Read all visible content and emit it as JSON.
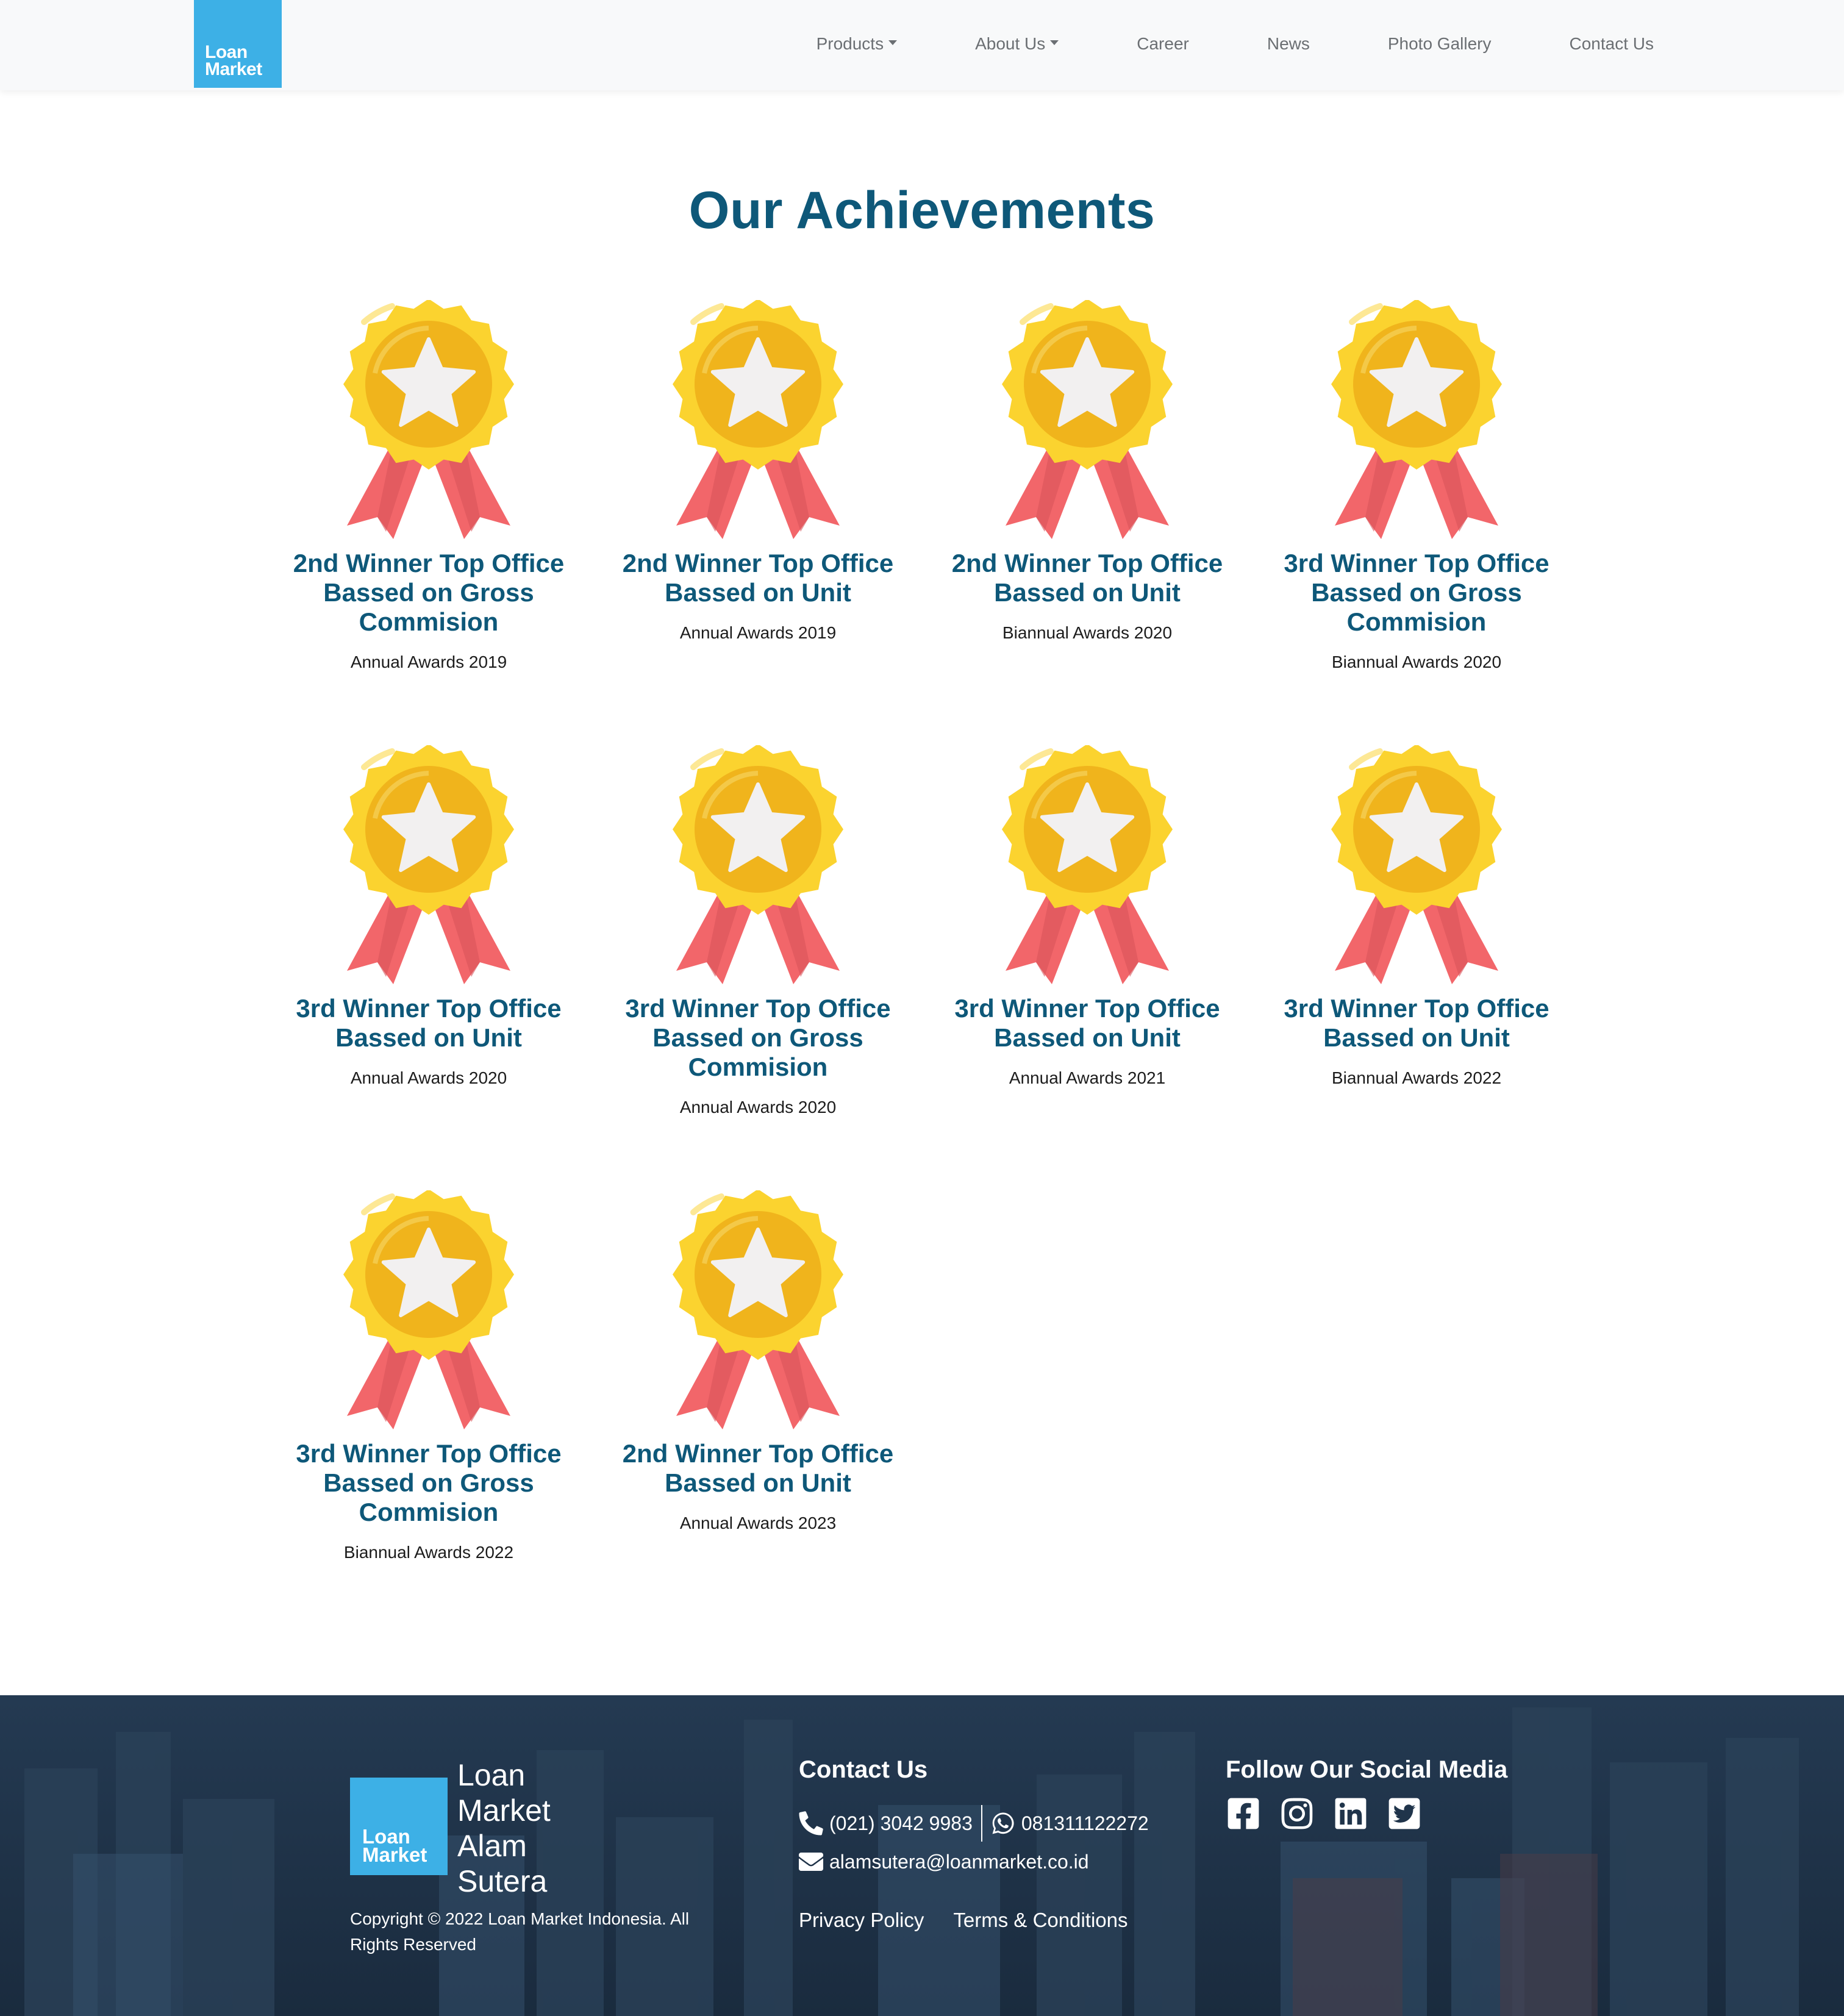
{
  "brand": {
    "line1": "Loan",
    "line2": "Market"
  },
  "nav": {
    "items": [
      {
        "label": "Products",
        "dropdown": true
      },
      {
        "label": "About Us",
        "dropdown": true
      },
      {
        "label": "Career",
        "dropdown": false
      },
      {
        "label": "News",
        "dropdown": false
      },
      {
        "label": "Photo Gallery",
        "dropdown": false
      },
      {
        "label": "Contact Us",
        "dropdown": false
      }
    ]
  },
  "main": {
    "title": "Our Achievements",
    "awards": [
      {
        "title": "2nd Winner Top Office Bassed on Gross Commision",
        "subtitle": "Annual Awards 2019"
      },
      {
        "title": "2nd Winner Top Office Bassed on Unit",
        "subtitle": "Annual Awards 2019"
      },
      {
        "title": "2nd Winner Top Office Bassed on Unit",
        "subtitle": "Biannual Awards 2020"
      },
      {
        "title": "3rd Winner Top Office Bassed on Gross Commision",
        "subtitle": "Biannual Awards 2020"
      },
      {
        "title": "3rd Winner Top Office Bassed on Unit",
        "subtitle": "Annual Awards 2020"
      },
      {
        "title": "3rd Winner Top Office Bassed on Gross Commision",
        "subtitle": "Annual Awards 2020"
      },
      {
        "title": "3rd Winner Top Office Bassed on Unit",
        "subtitle": "Annual Awards 2021"
      },
      {
        "title": "3rd Winner Top Office Bassed on Unit",
        "subtitle": "Biannual Awards 2022"
      },
      {
        "title": "3rd Winner Top Office Bassed on Gross Commision",
        "subtitle": "Biannual Awards 2022"
      },
      {
        "title": "2nd Winner Top Office Bassed on Unit",
        "subtitle": "Annual Awards 2023"
      }
    ]
  },
  "footer": {
    "logo": {
      "line1": "Loan",
      "line2": "Market"
    },
    "office_name": "Loan Market Alam Sutera",
    "copyright": "Copyright © 2022 Loan Market Indonesia. All Rights Reserved",
    "contact": {
      "title": "Contact Us",
      "phone": "(021) 3042 9983",
      "whatsapp": "081311122272",
      "email": "alamsutera@loanmarket.co.id"
    },
    "links": {
      "privacy": "Privacy Policy",
      "terms": "Terms & Conditions"
    },
    "social": {
      "title": "Follow Our Social Media",
      "icons": [
        "facebook-icon",
        "instagram-icon",
        "linkedin-icon",
        "twitter-icon"
      ]
    }
  },
  "colors": {
    "brand_blue": "#3db0e6",
    "heading_blue": "#0e5879",
    "medal_gold": "#fbd32f",
    "medal_inner": "#f0b41c",
    "ribbon_red": "#f2666a",
    "footer_bg": "#1d3146"
  }
}
